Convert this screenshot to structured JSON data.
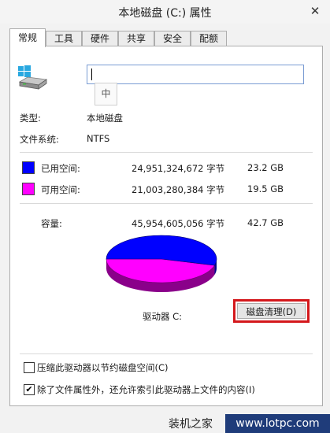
{
  "window": {
    "title": "本地磁盘 (C:) 属性",
    "close_glyph": "✕"
  },
  "tabs": [
    "常规",
    "工具",
    "硬件",
    "共享",
    "安全",
    "配额"
  ],
  "drive": {
    "name_value": "",
    "ime_indicator": "中",
    "type_label": "类型:",
    "type_value": "本地磁盘",
    "fs_label": "文件系统:",
    "fs_value": "NTFS"
  },
  "usage": {
    "used": {
      "label": "已用空间:",
      "bytes": "24,951,324,672 字节",
      "size": "23.2 GB",
      "color": "#0000ff"
    },
    "free": {
      "label": "可用空间:",
      "bytes": "21,003,280,384 字节",
      "size": "19.5 GB",
      "color": "#ff00ff"
    },
    "capacity": {
      "label": "容量:",
      "bytes": "45,954,605,056 字节",
      "size": "42.7 GB"
    }
  },
  "pie": {
    "used_fraction": 0.543
  },
  "drive_label": "驱动器 C:",
  "cleanup_button": "磁盘清理(D)",
  "options": [
    {
      "label": "压缩此驱动器以节约磁盘空间(C)",
      "checked": false
    },
    {
      "label": "除了文件属性外，还允许索引此驱动器上文件的内容(I)",
      "checked": true
    }
  ],
  "watermark": {
    "cn": "装机之家",
    "url": "www.lotpc.com"
  }
}
